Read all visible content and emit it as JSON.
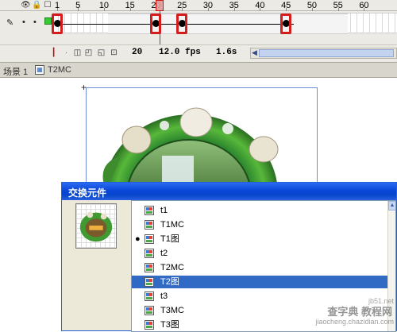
{
  "timeline": {
    "ruler_labels": [
      "1",
      "5",
      "10",
      "15",
      "20",
      "25",
      "30",
      "35",
      "40",
      "45",
      "50",
      "55",
      "60"
    ],
    "current_frame": "20",
    "frame_rate": "12.0 fps",
    "elapsed_time": "1.6s",
    "keyframes": [
      1,
      20,
      25,
      45
    ],
    "highlighted_frames": [
      1,
      20,
      25,
      45
    ]
  },
  "editbar": {
    "scene": "场景 1",
    "symbol": "T2MC"
  },
  "dialog": {
    "title": "交换元件",
    "items": [
      {
        "label": "t1",
        "bullet": "",
        "selected": false
      },
      {
        "label": "T1MC",
        "bullet": "",
        "selected": false
      },
      {
        "label": "T1图",
        "bullet": "●",
        "selected": false
      },
      {
        "label": "t2",
        "bullet": "",
        "selected": false
      },
      {
        "label": "T2MC",
        "bullet": "",
        "selected": false
      },
      {
        "label": "T2图",
        "bullet": "",
        "selected": true
      },
      {
        "label": "t3",
        "bullet": "",
        "selected": false
      },
      {
        "label": "T3MC",
        "bullet": "",
        "selected": false
      },
      {
        "label": "T3图",
        "bullet": "",
        "selected": false
      }
    ]
  },
  "watermark": {
    "main": "查字典 教程网",
    "sub": "jiaocheng.chazidian.com",
    "corner": "jb51.net"
  },
  "colors": {
    "selection": "#316ac5",
    "keyframe_highlight": "#d41d1d",
    "layer_color": "#33cc33",
    "titlebar": "#0a46d8"
  }
}
